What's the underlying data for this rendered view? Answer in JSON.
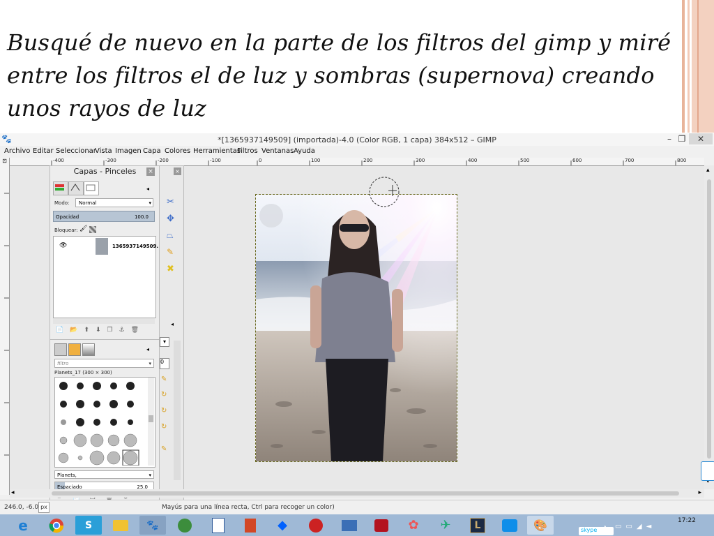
{
  "slide": {
    "lines": [
      "Busqué de nuevo en la parte de los filtros del gimp y miré",
      "entre los filtros el de luz y sombras (supernova) creando",
      "unos rayos de luz"
    ]
  },
  "window": {
    "title": "*[1365937149509] (importada)-4.0 (Color RGB, 1 capa) 384x512 – GIMP",
    "minimize": "–",
    "maximize": "❐",
    "close": "✕"
  },
  "menu": [
    "Archivo",
    "Editar",
    "Seleccionar",
    "Vista",
    "Imagen",
    "Capa",
    "Colores",
    "Herramientas",
    "Filtros",
    "Ventanas",
    "Ayuda"
  ],
  "ruler": {
    "labels": [
      "-400",
      "-300",
      "-200",
      "-100",
      "0",
      "100",
      "200",
      "300",
      "400",
      "500",
      "600",
      "700",
      "800"
    ]
  },
  "dock": {
    "title": "Capas - Pinceles",
    "close": "×",
    "mode_label": "Modo:",
    "mode_value": "Normal",
    "opacity_label": "Opacidad",
    "opacity_value": "100.0",
    "lock_label": "Bloquear:",
    "layer_name": "1365937149509.",
    "brush_filter_placeholder": "filtro",
    "brush_name": "Planets_17 (300 × 300)",
    "brush_tag": "Planets,",
    "spacing_label": "Espaciado",
    "spacing_value": "25.0"
  },
  "status": {
    "coords": "246.0, -6.0",
    "unit": "px",
    "message": "Mayús para una línea recta, Ctrl para recoger un color)"
  },
  "taskbar": {
    "time": "17:22",
    "skype_label": "skype",
    "icons": [
      "ie-icon",
      "chrome-icon",
      "skype-icon",
      "file-explorer-icon",
      "gimp-icon",
      "earth-icon",
      "word-icon",
      "powerpoint-icon",
      "dropbox-icon",
      "game-icon",
      "network-icon",
      "media-icon",
      "paint-icon",
      "app-icon",
      "league-icon",
      "teamviewer-icon",
      "gimp-active-icon"
    ]
  },
  "colors": {
    "taskbar": "#9fb9d6",
    "accent": "#e8b49a"
  }
}
